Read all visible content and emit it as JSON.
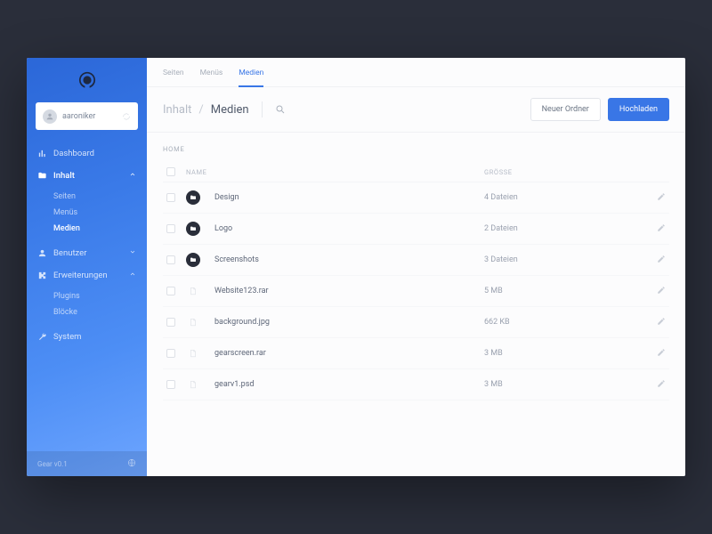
{
  "sidebar": {
    "user": {
      "name": "aaroniker"
    },
    "items": [
      {
        "label": "Dashboard",
        "icon": "chart"
      },
      {
        "label": "Inhalt",
        "icon": "folder",
        "expanded": true,
        "active": true,
        "sub": [
          {
            "label": "Seiten"
          },
          {
            "label": "Menüs"
          },
          {
            "label": "Medien",
            "active": true
          }
        ]
      },
      {
        "label": "Benutzer",
        "icon": "user",
        "expanded": false
      },
      {
        "label": "Erweiterungen",
        "icon": "puzzle",
        "expanded": true,
        "sub": [
          {
            "label": "Plugins"
          },
          {
            "label": "Blöcke"
          }
        ]
      },
      {
        "label": "System",
        "icon": "wrench"
      }
    ],
    "footer": {
      "version": "Gear v0.1"
    }
  },
  "tabs": [
    {
      "label": "Seiten"
    },
    {
      "label": "Menüs"
    },
    {
      "label": "Medien",
      "active": true
    }
  ],
  "breadcrumb": {
    "parent": "Inhalt",
    "current": "Medien"
  },
  "actions": {
    "new_folder": "Neuer Ordner",
    "upload": "Hochladen"
  },
  "content": {
    "home_label": "HOME",
    "columns": {
      "name": "NAME",
      "size": "GRÖSSE"
    },
    "rows": [
      {
        "type": "folder",
        "name": "Design",
        "size": "4 Dateien"
      },
      {
        "type": "folder",
        "name": "Logo",
        "size": "2 Dateien"
      },
      {
        "type": "folder",
        "name": "Screenshots",
        "size": "3 Dateien"
      },
      {
        "type": "file",
        "name": "Website123.rar",
        "size": "5 MB"
      },
      {
        "type": "file",
        "name": "background.jpg",
        "size": "662 KB"
      },
      {
        "type": "file",
        "name": "gearscreen.rar",
        "size": "3 MB"
      },
      {
        "type": "file",
        "name": "gearv1.psd",
        "size": "3 MB"
      }
    ]
  }
}
